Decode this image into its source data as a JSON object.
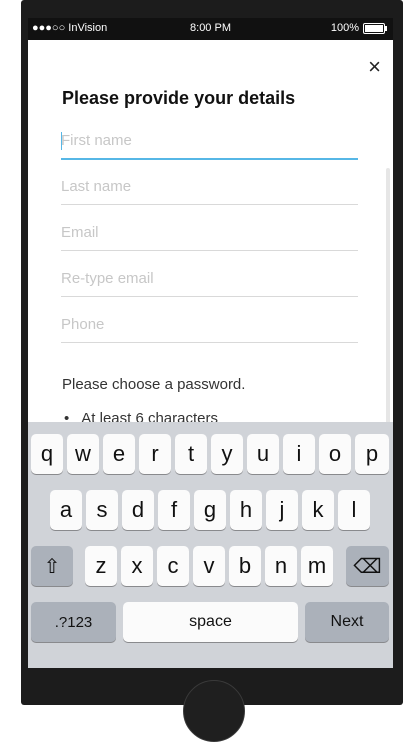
{
  "status_bar": {
    "carrier": "●●●○○ InVision",
    "time": "8:00 PM",
    "battery": "100%"
  },
  "form": {
    "title": "Please provide your details",
    "close_label": "×",
    "fields": [
      {
        "placeholder": "First name",
        "value": ""
      },
      {
        "placeholder": "Last name",
        "value": ""
      },
      {
        "placeholder": "Email",
        "value": ""
      },
      {
        "placeholder": "Re-type email",
        "value": ""
      },
      {
        "placeholder": "Phone",
        "value": ""
      }
    ],
    "password_prompt": "Please choose a password.",
    "rules": [
      "At least 6 characters"
    ]
  },
  "keyboard": {
    "row1": [
      "q",
      "w",
      "e",
      "r",
      "t",
      "y",
      "u",
      "i",
      "o",
      "p"
    ],
    "row2": [
      "a",
      "s",
      "d",
      "f",
      "g",
      "h",
      "j",
      "k",
      "l"
    ],
    "row3": [
      "z",
      "x",
      "c",
      "v",
      "b",
      "n",
      "m"
    ],
    "shift": "⇧",
    "delete": "⌫",
    "numbers": ".?123",
    "space": "space",
    "next": "Next"
  },
  "colors": {
    "focus": "#56b7e6",
    "keyboard_bg": "#d0d3d8",
    "frame": "#1c1c1c"
  }
}
